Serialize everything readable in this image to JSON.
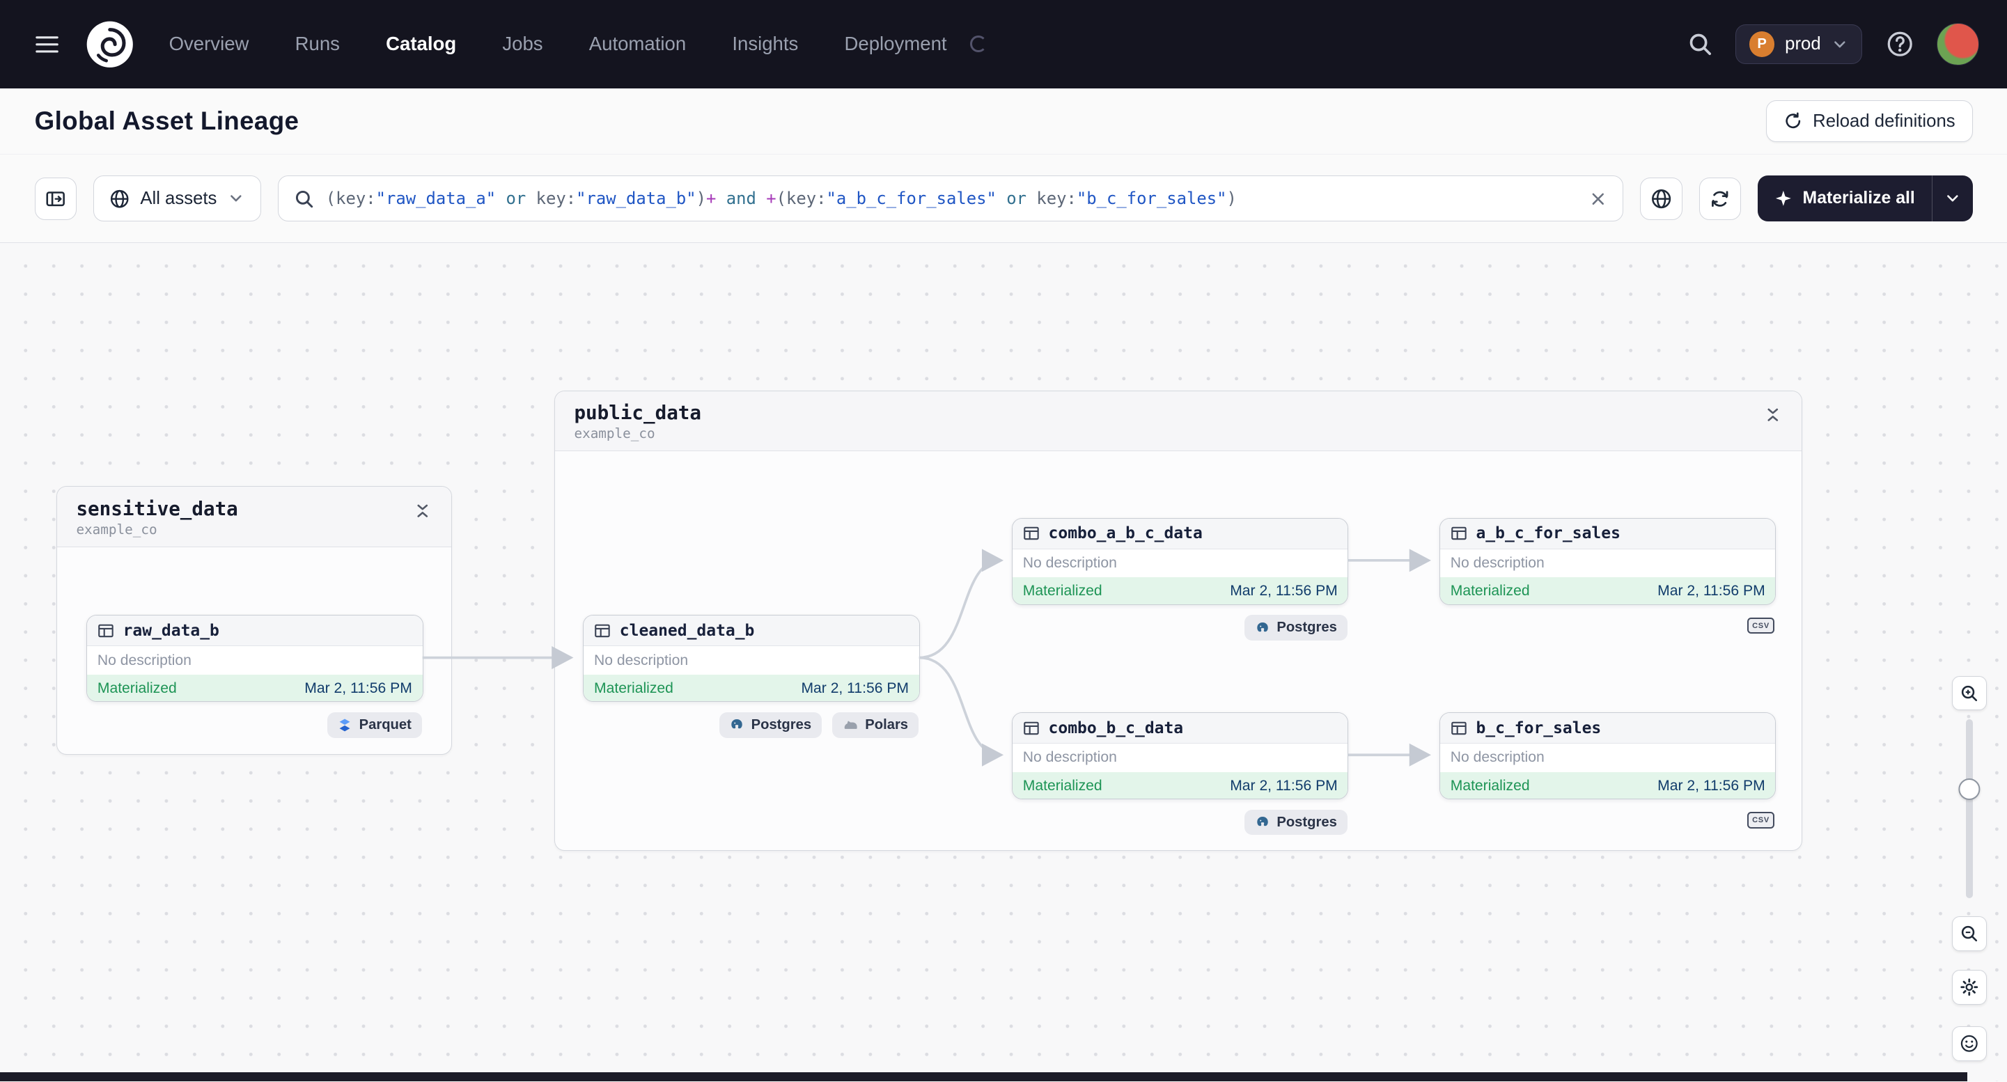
{
  "nav": {
    "items": [
      {
        "label": "Overview",
        "active": false
      },
      {
        "label": "Runs",
        "active": false
      },
      {
        "label": "Catalog",
        "active": true
      },
      {
        "label": "Jobs",
        "active": false
      },
      {
        "label": "Automation",
        "active": false
      },
      {
        "label": "Insights",
        "active": false
      },
      {
        "label": "Deployment",
        "active": false
      }
    ],
    "deployment_badge": "P",
    "deployment_name": "prod"
  },
  "header": {
    "title": "Global Asset Lineage",
    "reload_button_label": "Reload definitions"
  },
  "toolbar": {
    "scope_label": "All assets",
    "materialize_label": "Materialize all",
    "query_tokens": [
      {
        "t": "punct",
        "v": "("
      },
      {
        "t": "attr",
        "v": "key:"
      },
      {
        "t": "str",
        "v": "\"raw_data_a\""
      },
      {
        "t": "op",
        "v": " or "
      },
      {
        "t": "attr",
        "v": "key:"
      },
      {
        "t": "str",
        "v": "\"raw_data_b\""
      },
      {
        "t": "punct",
        "v": ")"
      },
      {
        "t": "plus",
        "v": "+"
      },
      {
        "t": "op",
        "v": " and "
      },
      {
        "t": "plus",
        "v": "+"
      },
      {
        "t": "punct",
        "v": "("
      },
      {
        "t": "attr",
        "v": "key:"
      },
      {
        "t": "str",
        "v": "\"a_b_c_for_sales\""
      },
      {
        "t": "op",
        "v": " or "
      },
      {
        "t": "attr",
        "v": "key:"
      },
      {
        "t": "str",
        "v": "\"b_c_for_sales\""
      },
      {
        "t": "punct",
        "v": ")"
      }
    ]
  },
  "graph": {
    "groups": [
      {
        "name": "sensitive_data",
        "subtitle": "example_co"
      },
      {
        "name": "public_data",
        "subtitle": "example_co"
      }
    ],
    "nodes": [
      {
        "title": "raw_data_b",
        "description": "No description",
        "status": "Materialized",
        "timestamp": "Mar 2, 11:56 PM"
      },
      {
        "title": "cleaned_data_b",
        "description": "No description",
        "status": "Materialized",
        "timestamp": "Mar 2, 11:56 PM"
      },
      {
        "title": "combo_a_b_c_data",
        "description": "No description",
        "status": "Materialized",
        "timestamp": "Mar 2, 11:56 PM"
      },
      {
        "title": "combo_b_c_data",
        "description": "No description",
        "status": "Materialized",
        "timestamp": "Mar 2, 11:56 PM"
      },
      {
        "title": "a_b_c_for_sales",
        "description": "No description",
        "status": "Materialized",
        "timestamp": "Mar 2, 11:56 PM"
      },
      {
        "title": "b_c_for_sales",
        "description": "No description",
        "status": "Materialized",
        "timestamp": "Mar 2, 11:56 PM"
      }
    ],
    "tags": {
      "parquet": "Parquet",
      "postgres": "Postgres",
      "polars": "Polars",
      "csv": "CSV"
    }
  },
  "icons": [
    "hamburger-icon",
    "dagster-logo-icon",
    "spinner-icon",
    "search-icon",
    "chevron-down-icon",
    "question-icon",
    "panel-toggle-icon",
    "globe-icon",
    "refresh-icon",
    "close-icon",
    "sparkle-icon",
    "reload-icon",
    "table-icon",
    "collapse-icon",
    "parquet-icon",
    "postgres-icon",
    "polars-icon",
    "csv-icon",
    "zoom-in-icon",
    "zoom-out-icon",
    "gear-icon",
    "smiley-icon"
  ],
  "colors": {
    "nav_bg": "#14141F",
    "accent_dark_button": "#1D1D30",
    "materialized_bg": "#E3F5EA",
    "materialized_text": "#1D9455",
    "timestamp_text": "#113C6B",
    "edge": "#CDD2DA",
    "badge_orange": "#D97E2F"
  }
}
